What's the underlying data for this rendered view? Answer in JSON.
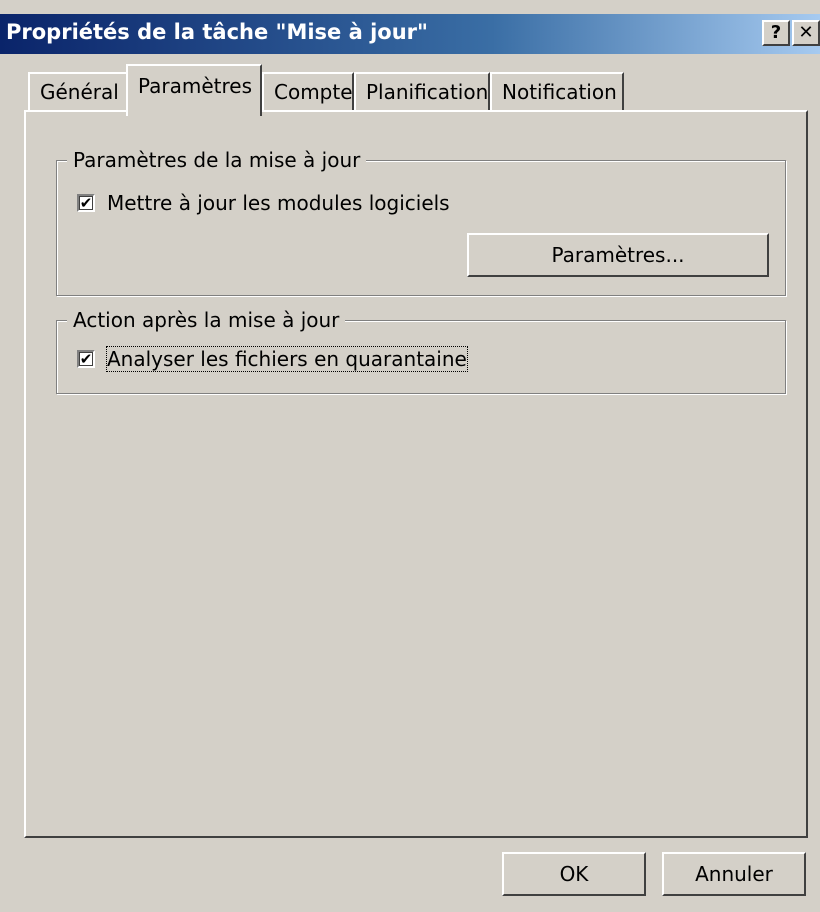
{
  "window": {
    "title": "Propriétés de la tâche \"Mise à jour\"",
    "help_glyph": "?",
    "close_glyph": "✕"
  },
  "tabs": [
    {
      "label": "Général",
      "active": false
    },
    {
      "label": "Paramètres",
      "active": true,
      "mnemonic": "P"
    },
    {
      "label": "Compte",
      "active": false
    },
    {
      "label": "Planification",
      "active": false
    },
    {
      "label": "Notification",
      "active": false
    }
  ],
  "update_settings": {
    "legend": "Paramètres de la mise à jour",
    "checkbox_label": "Mettre à jour les modules logiciels",
    "checked": true,
    "button_label": "Paramètres..."
  },
  "post_update": {
    "legend": "Action après la mise à jour",
    "checkbox_label": "Analyser les fichiers en quarantaine",
    "checked": true
  },
  "footer": {
    "ok_label": "OK",
    "cancel_label": "Annuler"
  },
  "colors": {
    "face": "#d4d0c8",
    "titlebar_start": "#0a246a",
    "titlebar_end": "#a6caf0"
  },
  "check_glyph": "✔"
}
